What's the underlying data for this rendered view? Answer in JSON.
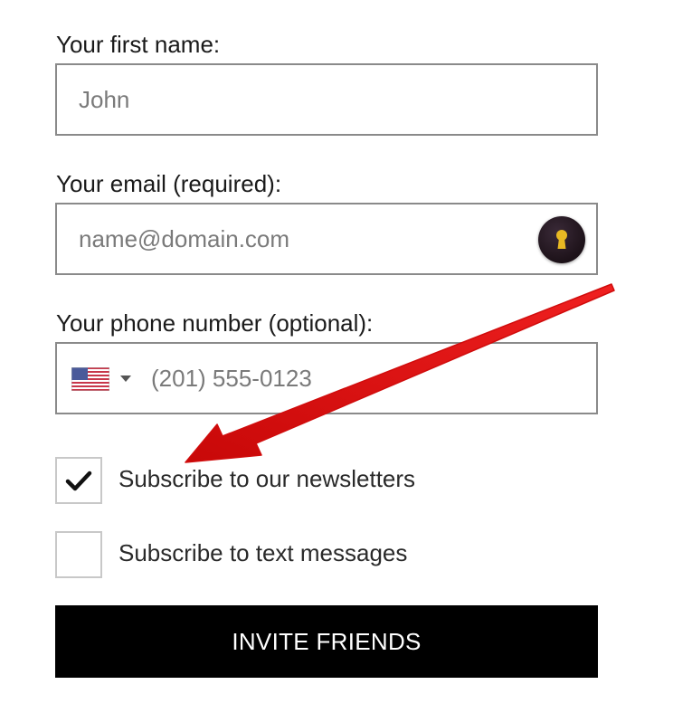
{
  "form": {
    "first_name": {
      "label": "Your first name:",
      "placeholder": "John",
      "value": ""
    },
    "email": {
      "label": "Your email (required):",
      "placeholder": "name@domain.com",
      "value": "",
      "autofill_icon": "keyhole-icon"
    },
    "phone": {
      "label": "Your phone number (optional):",
      "placeholder": "(201) 555-0123",
      "value": "",
      "country_flag": "us-flag-icon"
    },
    "checkboxes": [
      {
        "label": "Subscribe to our newsletters",
        "checked": true
      },
      {
        "label": "Subscribe to text messages",
        "checked": false
      }
    ],
    "submit_label": "INVITE FRIENDS"
  },
  "colors": {
    "button_bg": "#000000",
    "button_text": "#ffffff",
    "annotation_arrow": "#e01010",
    "field_border": "#8a8a8a",
    "keyhole_gold": "#e8b923"
  }
}
